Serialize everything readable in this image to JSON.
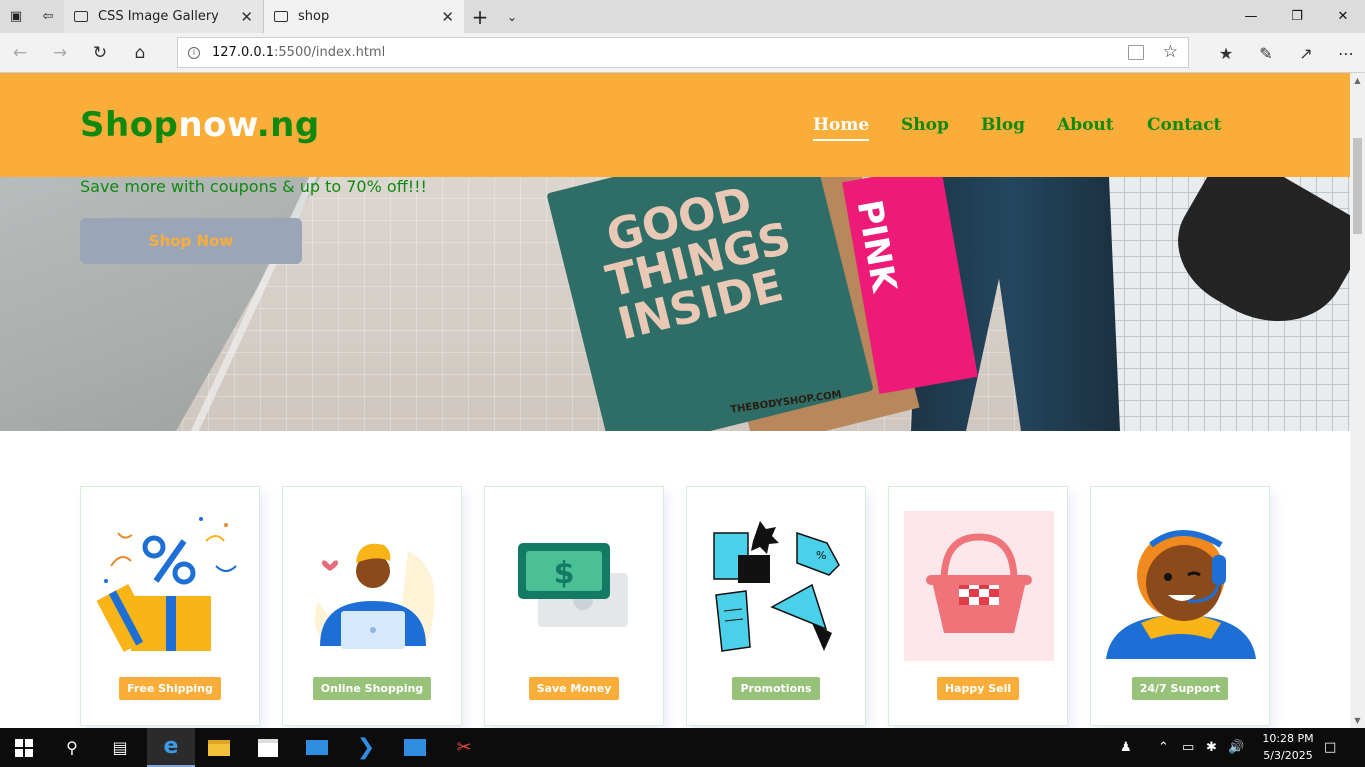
{
  "browser": {
    "tabs": [
      {
        "label": "CSS Image Gallery",
        "active": false
      },
      {
        "label": "shop",
        "active": true
      }
    ],
    "address": {
      "host": "127.0.0.1",
      "path": ":5500/index.html"
    }
  },
  "site": {
    "logo": {
      "part1": "Shop",
      "part2": "now",
      "part3": ".ng"
    },
    "nav": [
      "Home",
      "Shop",
      "Blog",
      "About",
      "Contact"
    ],
    "active_nav": "Home",
    "hero": {
      "tagline": "Save more with coupons & up to 70% off!!!",
      "cta": "Shop Now",
      "bag_text": "GOOD THINGS INSIDE",
      "pink_text": "PINK",
      "bag_brand": "THEBODYSHOP.COM"
    },
    "features": [
      {
        "label": "Free Shipping",
        "color": "#fbad3a"
      },
      {
        "label": "Online Shopping",
        "color": "#98c27a"
      },
      {
        "label": "Save Money",
        "color": "#fbad3a"
      },
      {
        "label": "Promotions",
        "color": "#98c27a"
      },
      {
        "label": "Happy Sell",
        "color": "#fbad3a"
      },
      {
        "label": "24/7 Support",
        "color": "#98c27a"
      }
    ],
    "colors": {
      "header": "#fbad3a",
      "brand_green": "#0f8a0f"
    }
  },
  "taskbar": {
    "time": "10:28 PM",
    "date": "5/3/2025"
  }
}
